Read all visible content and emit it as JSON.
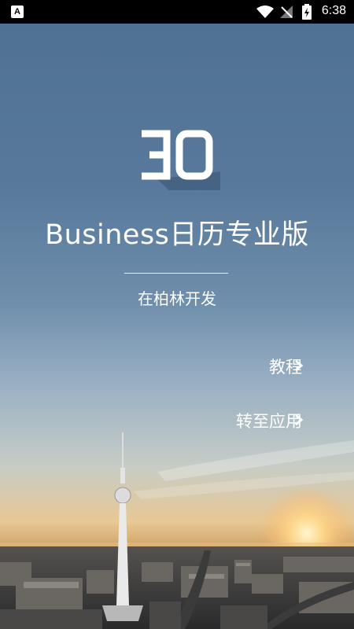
{
  "status_bar": {
    "time": "6:38",
    "icons": [
      "notification-a-icon",
      "wifi-icon",
      "signal-icon",
      "battery-charging-icon"
    ],
    "notification_label": "A"
  },
  "app": {
    "logo_text": "30",
    "title": "Business日历专业版",
    "subtitle": "在柏林开发"
  },
  "links": {
    "tutorial": "教程",
    "go_to_app": "转至应用"
  },
  "colors": {
    "sky_top": "#4e7092",
    "status_bar": "#000000",
    "text": "#ffffff"
  }
}
